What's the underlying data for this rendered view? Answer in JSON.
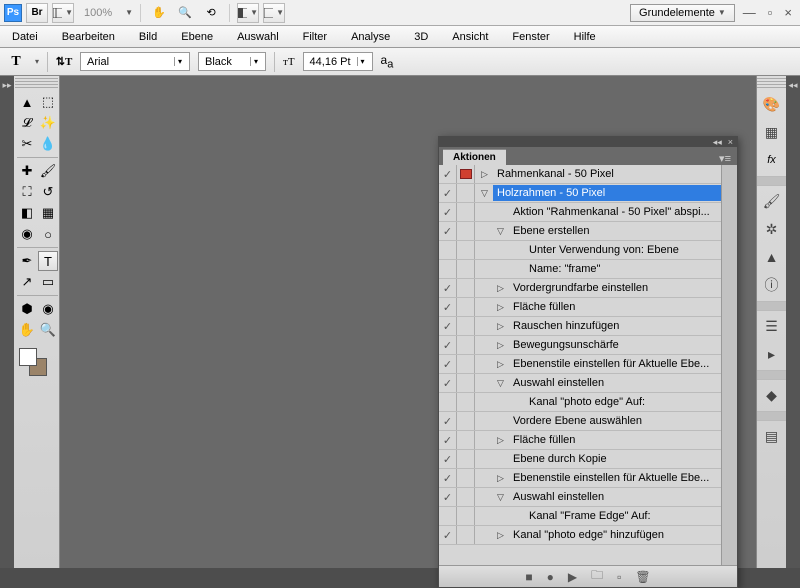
{
  "topbar": {
    "zoom": "100%",
    "workspace": "Grundelemente"
  },
  "menu": [
    "Datei",
    "Bearbeiten",
    "Bild",
    "Ebene",
    "Auswahl",
    "Filter",
    "Analyse",
    "3D",
    "Ansicht",
    "Fenster",
    "Hilfe"
  ],
  "opt": {
    "font": "Arial",
    "style": "Black",
    "size": "44,16 Pt"
  },
  "panel": {
    "title": "Aktionen"
  },
  "actions": [
    {
      "chk": true,
      "mod": true,
      "depth": 0,
      "tri": "right",
      "label": "Rahmenkanal - 50 Pixel",
      "sel": false
    },
    {
      "chk": true,
      "mod": false,
      "depth": 0,
      "tri": "down",
      "label": "Holzrahmen - 50 Pixel",
      "sel": true
    },
    {
      "chk": true,
      "mod": false,
      "depth": 1,
      "tri": "",
      "label": "Aktion \"Rahmenkanal - 50 Pixel\" abspi...",
      "sel": false
    },
    {
      "chk": true,
      "mod": false,
      "depth": 1,
      "tri": "down",
      "label": "Ebene erstellen",
      "sel": false
    },
    {
      "chk": null,
      "mod": null,
      "depth": 2,
      "tri": "",
      "label": "Unter Verwendung von: Ebene",
      "sel": false
    },
    {
      "chk": null,
      "mod": null,
      "depth": 2,
      "tri": "",
      "label": "Name:  \"frame\"",
      "sel": false
    },
    {
      "chk": true,
      "mod": false,
      "depth": 1,
      "tri": "right",
      "label": "Vordergrundfarbe einstellen",
      "sel": false
    },
    {
      "chk": true,
      "mod": false,
      "depth": 1,
      "tri": "right",
      "label": "Fläche füllen",
      "sel": false
    },
    {
      "chk": true,
      "mod": false,
      "depth": 1,
      "tri": "right",
      "label": "Rauschen hinzufügen",
      "sel": false
    },
    {
      "chk": true,
      "mod": false,
      "depth": 1,
      "tri": "right",
      "label": "Bewegungsunschärfe",
      "sel": false
    },
    {
      "chk": true,
      "mod": false,
      "depth": 1,
      "tri": "right",
      "label": "Ebenenstile einstellen  für Aktuelle Ebe...",
      "sel": false
    },
    {
      "chk": true,
      "mod": false,
      "depth": 1,
      "tri": "down",
      "label": "Auswahl einstellen",
      "sel": false
    },
    {
      "chk": null,
      "mod": null,
      "depth": 2,
      "tri": "",
      "label": "Kanal \"photo edge\" Auf:",
      "sel": false
    },
    {
      "chk": true,
      "mod": false,
      "depth": 1,
      "tri": "",
      "label": "Vordere Ebene auswählen",
      "sel": false
    },
    {
      "chk": true,
      "mod": false,
      "depth": 1,
      "tri": "right",
      "label": "Fläche füllen",
      "sel": false
    },
    {
      "chk": true,
      "mod": false,
      "depth": 1,
      "tri": "",
      "label": "Ebene durch Kopie",
      "sel": false
    },
    {
      "chk": true,
      "mod": false,
      "depth": 1,
      "tri": "right",
      "label": "Ebenenstile einstellen  für Aktuelle Ebe...",
      "sel": false
    },
    {
      "chk": true,
      "mod": false,
      "depth": 1,
      "tri": "down",
      "label": "Auswahl einstellen",
      "sel": false
    },
    {
      "chk": null,
      "mod": null,
      "depth": 2,
      "tri": "",
      "label": "Kanal \"Frame Edge\" Auf:",
      "sel": false
    },
    {
      "chk": true,
      "mod": false,
      "depth": 1,
      "tri": "right",
      "label": "Kanal \"photo edge\" hinzufügen",
      "sel": false
    }
  ]
}
